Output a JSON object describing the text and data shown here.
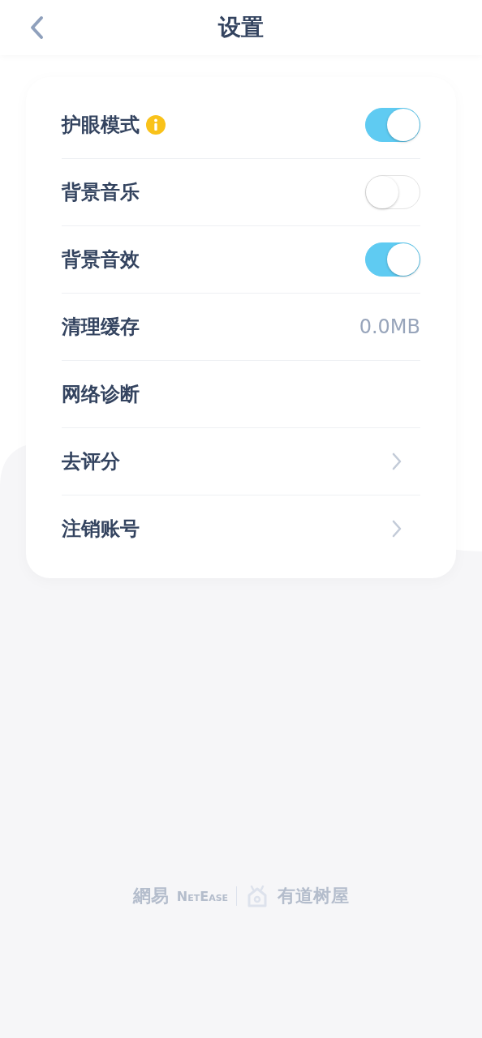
{
  "header": {
    "title": "设置"
  },
  "settings": [
    {
      "kind": "toggle",
      "label": "护眼模式",
      "info": true,
      "on": true
    },
    {
      "kind": "toggle",
      "label": "背景音乐",
      "on": false
    },
    {
      "kind": "toggle",
      "label": "背景音效",
      "on": true
    },
    {
      "kind": "value",
      "label": "清理缓存",
      "value": "0.0MB"
    },
    {
      "kind": "plain",
      "label": "网络诊断"
    },
    {
      "kind": "link",
      "label": "去评分"
    },
    {
      "kind": "link",
      "label": "注销账号"
    }
  ],
  "footer": {
    "brand": "網易",
    "brand_latin": "NetEase",
    "product": "有道树屋"
  }
}
